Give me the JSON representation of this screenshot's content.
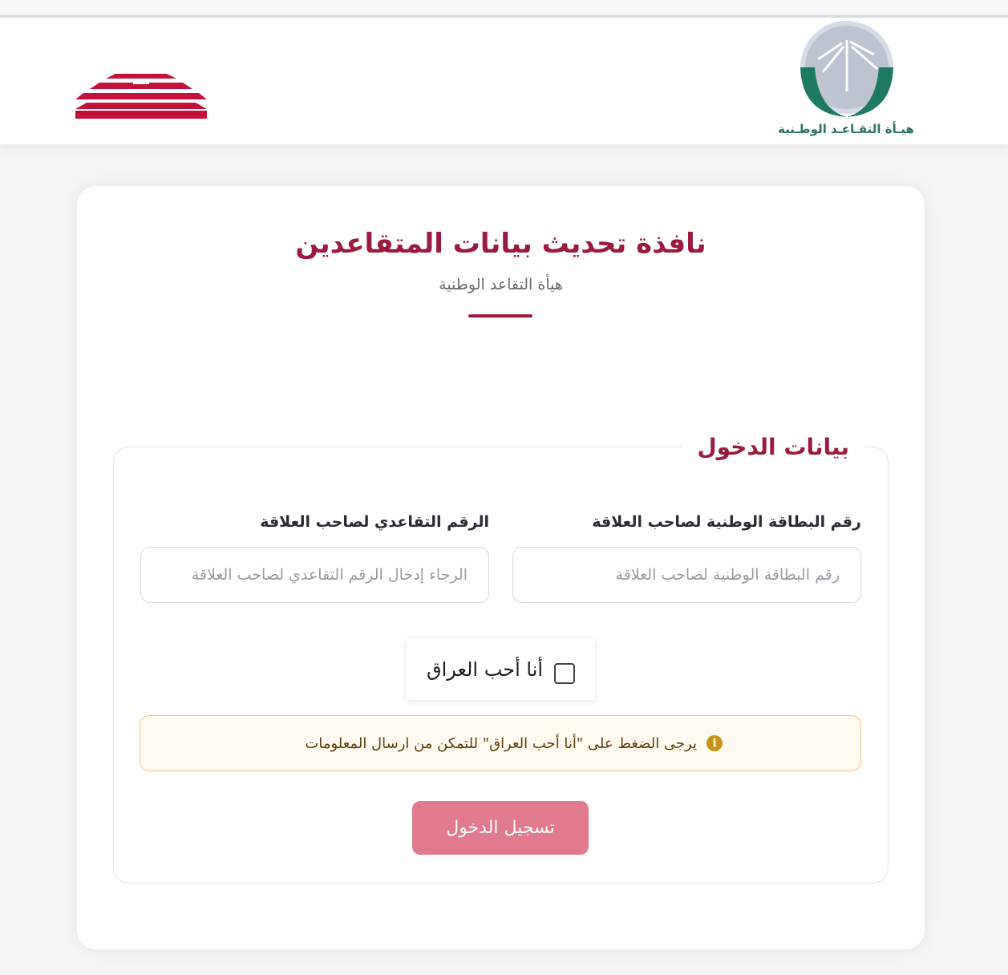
{
  "header": {
    "logo_caption": "هيـأة التقـاعـد الوطـنية"
  },
  "page": {
    "title": "نافذة تحديث بيانات المتقاعدين",
    "subtitle": "هيأة التقاعد الوطنية"
  },
  "form": {
    "legend": "بيانات الدخول",
    "national_id": {
      "label": "رقم البطاقة الوطنية لصاحب العلاقة",
      "placeholder": "رقم البطاقة الوطنية لصاحب العلاقة",
      "value": ""
    },
    "retirement_number": {
      "label": "الرقم التقاعدي لصاحب العلاقة",
      "placeholder": "الرجاء إدخال الرقم التقاعدي لصاحب العلاقة",
      "value": ""
    },
    "checkbox_label": "أنا أحب العراق",
    "checkbox_checked": false,
    "alert_text": "يرجى الضغط على \"أنا أحب العراق\" للتمكن من ارسال المعلومات",
    "submit_label": "تسجيل الدخول"
  },
  "icons": {
    "brand": "national-retirement-authority-logo",
    "mark": "red-stepped-pyramid-logo",
    "alert": "info-circle-icon"
  },
  "colors": {
    "accent": "#9b1b3e",
    "button": "#e07a8d",
    "alert_border": "#f0c77c",
    "alert_icon": "#c89418",
    "logo_green": "#1f7a63"
  }
}
